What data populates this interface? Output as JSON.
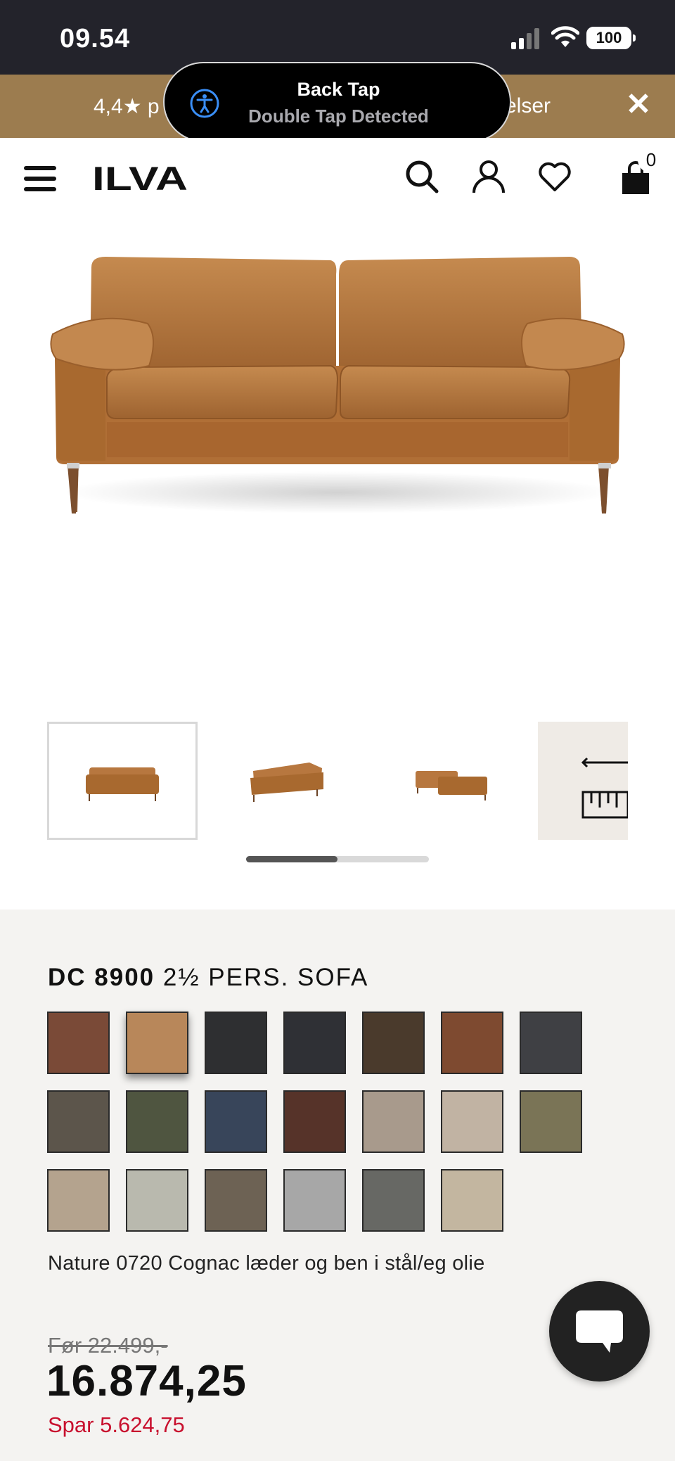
{
  "status_bar": {
    "time": "09.54",
    "battery": "100"
  },
  "promo": {
    "left_text": "4,4★ p",
    "right_text": "elser"
  },
  "toast": {
    "title": "Back Tap",
    "subtitle": "Double Tap Detected"
  },
  "header": {
    "logo": "ILVA",
    "cart_count": "0"
  },
  "product": {
    "title_bold": "DC 8900",
    "title_rest": "2½ PERS. SOFA",
    "variant": "Nature 0720 Cognac læder og ben i stål/eg olie",
    "old_price": "Før 22.499,-",
    "price": "16.874,25",
    "savings": "Spar 5.624,75"
  },
  "gallery": {
    "selected_index": 0,
    "scroll_fraction": 0.5
  },
  "swatches": [
    {
      "color": "#7a4a37"
    },
    {
      "color": "#b8875a",
      "selected": true
    },
    {
      "color": "#2e2f31"
    },
    {
      "color": "#2f3035"
    },
    {
      "color": "#4a3a2c"
    },
    {
      "color": "#7e4a30"
    },
    {
      "color": "#3f4044"
    },
    {
      "color": "#5c554b"
    },
    {
      "color": "#4f5540"
    },
    {
      "color": "#38455a"
    },
    {
      "color": "#563329"
    },
    {
      "color": "#a89a8c"
    },
    {
      "color": "#c1b3a3"
    },
    {
      "color": "#7a7456"
    },
    {
      "color": "#b4a38e"
    },
    {
      "color": "#b9b9ae"
    },
    {
      "color": "#6d6254"
    },
    {
      "color": "#a7a7a7"
    },
    {
      "color": "#676864"
    },
    {
      "color": "#c3b6a0"
    }
  ],
  "colors": {
    "promo_bg": "#9c7c4f",
    "status_bg": "#23232b",
    "sale_red": "#c8102e",
    "sofa": "#b7773f"
  }
}
